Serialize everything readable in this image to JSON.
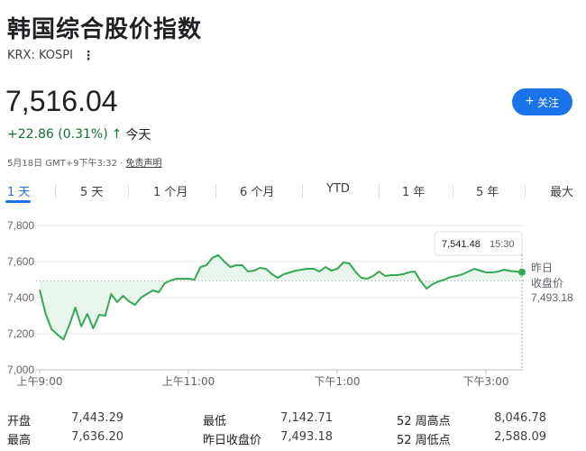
{
  "header": {
    "title": "韩国综合股价指数",
    "ticker": "KRX: KOSPI",
    "more_icon": "more-vert-icon"
  },
  "quote": {
    "price": "7,516.04",
    "change": "+22.86 (0.31%)",
    "change_arrow": "↑",
    "period": "今天",
    "follow_label": "关注",
    "timestamp": "5月18日 GMT+9下午3:32 · ",
    "disclaimer": "免责声明"
  },
  "tabs": [
    "1 天",
    "5 天",
    "1 个月",
    "6 个月",
    "YTD",
    "1 年",
    "5 年",
    "最大"
  ],
  "active_tab": 0,
  "colors": {
    "accent": "#1a73e8",
    "positive": "#137333",
    "line": "#34a853",
    "fill": "#e6f4ea"
  },
  "chart_data": {
    "type": "line",
    "y_ticks": [
      "7,800",
      "7,600",
      "7,400",
      "7,200",
      "7,000"
    ],
    "ylim": [
      7000,
      7800
    ],
    "x_ticks": [
      "上午9:00",
      "上午11:00",
      "下午1:00",
      "下午3:00"
    ],
    "tooltip": {
      "value": "7,541.48",
      "time": "15:30"
    },
    "prev_close_label_1": "昨日",
    "prev_close_label_2": "收盘价",
    "prev_close_value": "7,493.18",
    "prev_close": 7493.18,
    "series": [
      {
        "values": [
          7443,
          7310,
          7225,
          7195,
          7168,
          7250,
          7345,
          7240,
          7310,
          7230,
          7305,
          7300,
          7420,
          7375,
          7410,
          7380,
          7360,
          7400,
          7420,
          7440,
          7430,
          7480,
          7495,
          7505,
          7505,
          7505,
          7500,
          7570,
          7580,
          7620,
          7636,
          7600,
          7570,
          7580,
          7580,
          7545,
          7550,
          7565,
          7560,
          7530,
          7510,
          7530,
          7540,
          7550,
          7555,
          7560,
          7560,
          7545,
          7570,
          7550,
          7560,
          7595,
          7590,
          7545,
          7510,
          7505,
          7520,
          7545,
          7520,
          7525,
          7525,
          7530,
          7540,
          7545,
          7490,
          7450,
          7475,
          7490,
          7500,
          7515,
          7520,
          7530,
          7545,
          7560,
          7550,
          7540,
          7540,
          7545,
          7555,
          7548,
          7545,
          7541.48
        ]
      }
    ]
  },
  "stats": [
    {
      "label": "开盘",
      "value": "7,443.29"
    },
    {
      "label": "最低",
      "value": "7,142.71"
    },
    {
      "label": "52 周高点",
      "value": "8,046.78"
    },
    {
      "label": "最高",
      "value": "7,636.20"
    },
    {
      "label": "昨日收盘价",
      "value": "7,493.18"
    },
    {
      "label": "52 周低点",
      "value": "2,588.09"
    }
  ]
}
